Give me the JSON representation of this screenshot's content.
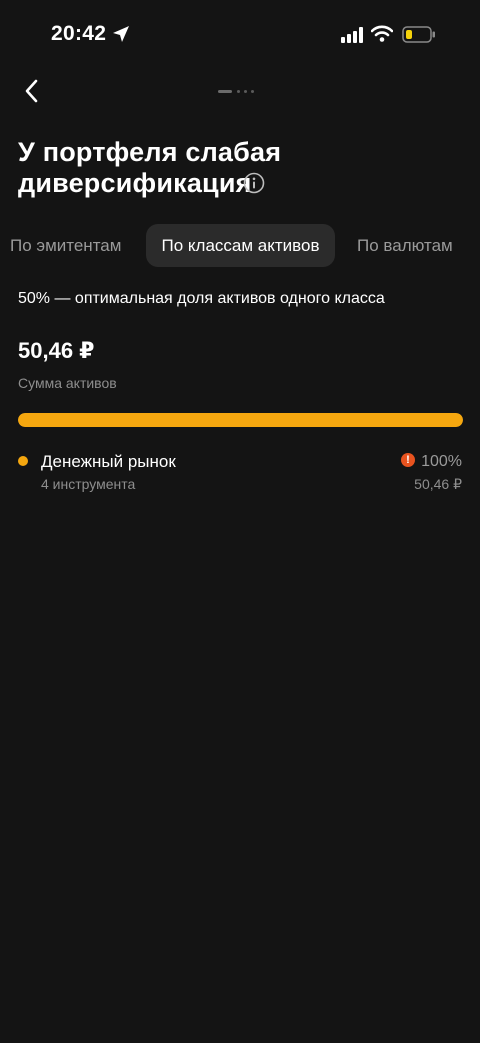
{
  "status_bar": {
    "time": "20:42"
  },
  "header": {
    "title": "У портфеля слабая диверсификация"
  },
  "tabs": [
    {
      "label": "По эмитентам",
      "selected": false
    },
    {
      "label": "По классам активов",
      "selected": true
    },
    {
      "label": "По валютам",
      "selected": false
    }
  ],
  "summary": {
    "hint": "50% — оптимальная доля активов одного класса",
    "total": "50,46 ₽",
    "total_caption": "Сумма активов"
  },
  "allocation": {
    "fill_fraction": 1.0,
    "color": "#f5a70f"
  },
  "assets": [
    {
      "name": "Денежный рынок",
      "instruments": "4 инструмента",
      "percent": "100%",
      "value": "50,46 ₽",
      "warning": "!",
      "color": "#f5a70f"
    }
  ],
  "colors": {
    "background": "#141414",
    "accent": "#f5a70f",
    "warning": "#e8531f",
    "tab_selected_bg": "#2b2b2b"
  }
}
